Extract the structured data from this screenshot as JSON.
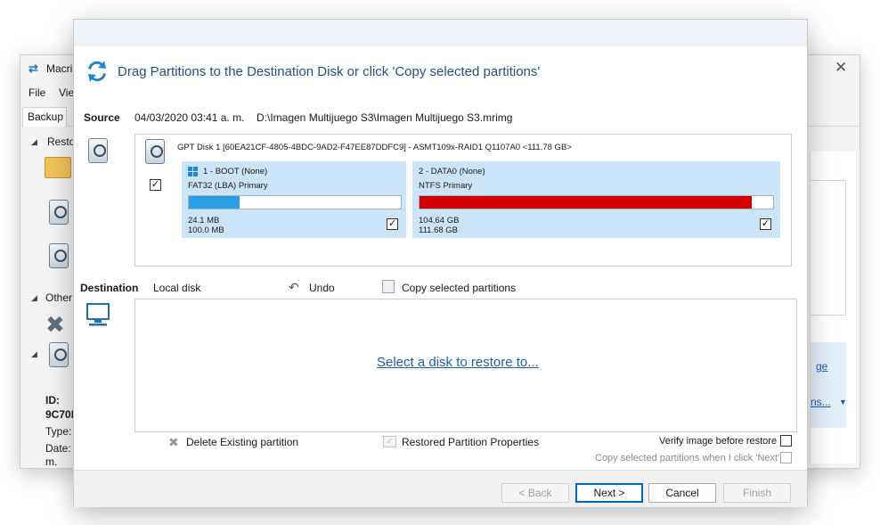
{
  "bg_window": {
    "title": "Macri",
    "menu": [
      "File",
      "Vie"
    ],
    "tab": "Backup",
    "left_items": [
      "Resto",
      "Other"
    ],
    "info": {
      "id_label": "ID:",
      "id_value": "9C70D",
      "type_label": "Type:",
      "date_label": "Date:",
      "date_tail": "m."
    },
    "right_links": [
      "ge",
      "ns..."
    ]
  },
  "dialog": {
    "header": "Drag Partitions to the Destination Disk or click 'Copy selected partitions'",
    "source": {
      "label": "Source",
      "datetime": "04/03/2020 03:41 a. m.",
      "path": "D:\\Imagen Multijuego S3\\Imagen Multijuego S3.mrimg",
      "disk_title": "GPT Disk 1 [60EA21CF-4805-4BDC-9AD2-F47EE87DDFC9] - ASMT109x-RAID1 Q1107A0  <111.78 GB>",
      "disk_checked": true,
      "partitions": [
        {
          "name": "1 - BOOT (None)",
          "type": "FAT32 (LBA) Primary",
          "used": "24.1 MB",
          "total": "100.0 MB",
          "fill_fraction": 0.24,
          "fill_color": "#2d9ee0",
          "checked": true
        },
        {
          "name": "2 - DATA0 (None)",
          "type": "NTFS Primary",
          "used": "104.64 GB",
          "total": "111.68 GB",
          "fill_fraction": 0.94,
          "fill_color": "#d40000",
          "checked": true
        }
      ]
    },
    "destination": {
      "label": "Destination",
      "local": "Local disk",
      "undo": "Undo",
      "copy": "Copy selected partitions",
      "select_link": "Select a disk to restore to..."
    },
    "options": {
      "delete": "Delete Existing partition",
      "restored_props": "Restored Partition Properties",
      "verify": "Verify image before restore",
      "verify_checked": false,
      "copy_next": "Copy selected partitions when I click 'Next'",
      "copy_next_checked": false
    },
    "buttons": {
      "back": "< Back",
      "next": "Next >",
      "cancel": "Cancel",
      "finish": "Finish"
    }
  }
}
